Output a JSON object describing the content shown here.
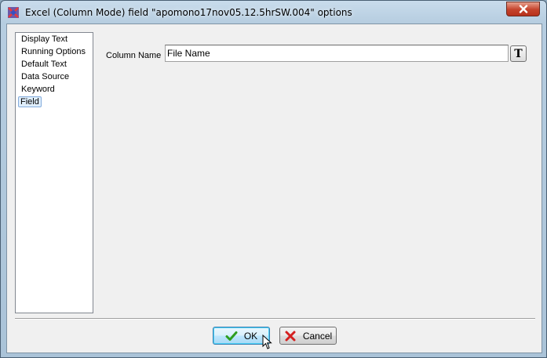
{
  "window": {
    "title": "Excel (Column Mode) field \"apomono17nov05.12.5hrSW.004\" options"
  },
  "nav": {
    "items": [
      {
        "label": "Display Text",
        "selected": false
      },
      {
        "label": "Running Options",
        "selected": false
      },
      {
        "label": "Default Text",
        "selected": false
      },
      {
        "label": "Data Source",
        "selected": false
      },
      {
        "label": "Keyword",
        "selected": false
      },
      {
        "label": "Field",
        "selected": true
      }
    ]
  },
  "field": {
    "column_name_label": "Column Name",
    "column_name_value": "File Name",
    "text_button_label": "T"
  },
  "buttons": {
    "ok_label": "OK",
    "cancel_label": "Cancel"
  },
  "icons": {
    "app": "app-icon",
    "close": "close-icon",
    "ok": "checkmark-icon",
    "cancel": "x-icon",
    "cursor": "mouse-pointer-icon"
  },
  "colors": {
    "selection_bg": "#dfeefb",
    "ok_check": "#2e9e1e",
    "cancel_x": "#d42020",
    "close_button": "#c4422b"
  }
}
